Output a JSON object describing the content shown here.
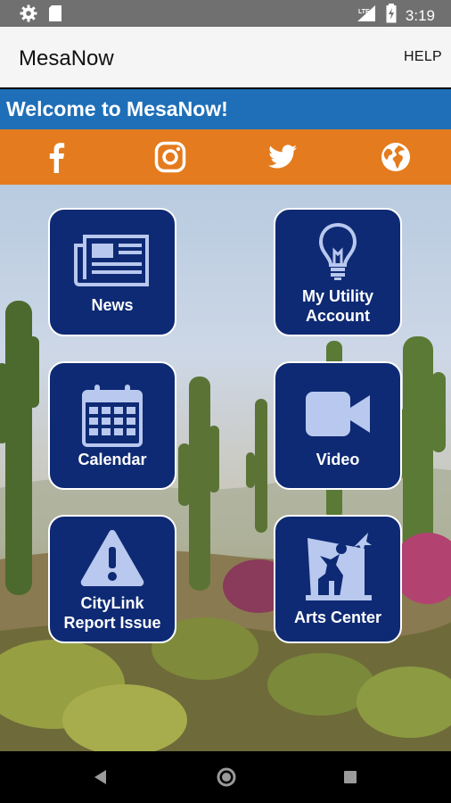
{
  "status_bar": {
    "time": "3:19",
    "network": "LTE"
  },
  "app_bar": {
    "title": "MesaNow",
    "help_label": "HELP"
  },
  "welcome": {
    "text": "Welcome to MesaNow!"
  },
  "social": [
    "facebook-icon",
    "instagram-icon",
    "twitter-icon",
    "globe-icon"
  ],
  "tiles": [
    {
      "label": "News",
      "icon": "newspaper-icon"
    },
    {
      "label": "My Utility Account",
      "line1": "My Utility",
      "line2": "Account",
      "icon": "lightbulb-icon"
    },
    {
      "label": "Calendar",
      "icon": "calendar-icon"
    },
    {
      "label": "Video",
      "icon": "video-camera-icon"
    },
    {
      "label": "CityLink Report Issue",
      "line1": "CityLink",
      "line2": "Report Issue",
      "icon": "warning-icon"
    },
    {
      "label": "Arts Center",
      "icon": "arts-center-icon"
    }
  ],
  "colors": {
    "welcome_bar": "#1f6fb8",
    "social_bar": "#e47b1e",
    "tile": "#0e2a74",
    "tile_icon": "#b9c8ee"
  }
}
